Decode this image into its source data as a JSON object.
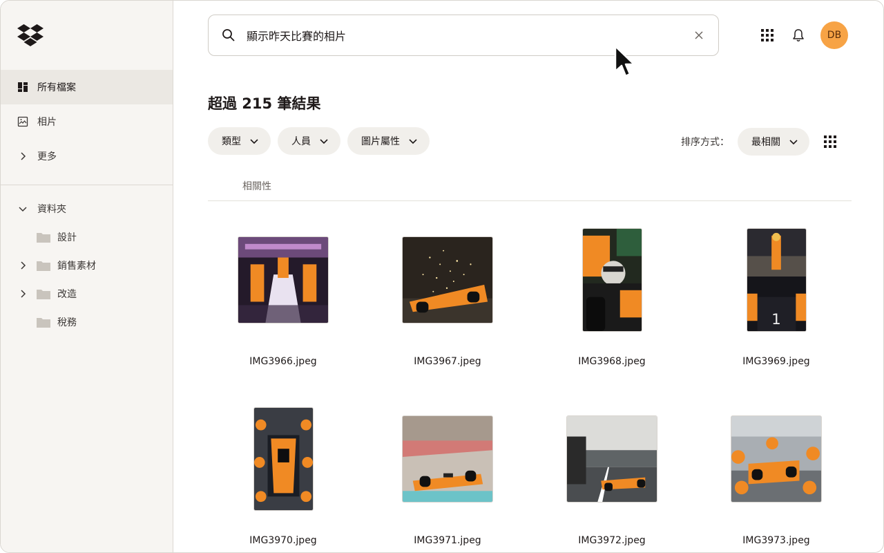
{
  "sidebar": {
    "logo_icon": "dropbox-logo",
    "nav": [
      {
        "label": "所有檔案",
        "icon": "all-files-icon",
        "active": true
      },
      {
        "label": "相片",
        "icon": "photos-icon",
        "active": false
      },
      {
        "label": "更多",
        "icon": "chevron-right-icon",
        "active": false
      }
    ],
    "folders_header": "資料夾",
    "folders": [
      {
        "label": "設計",
        "expandable": false
      },
      {
        "label": "銷售素材",
        "expandable": true
      },
      {
        "label": "改造",
        "expandable": true
      },
      {
        "label": "稅務",
        "expandable": false
      }
    ]
  },
  "search": {
    "value": "顯示昨天比賽的相片",
    "icon": "search-icon",
    "clear_icon": "close-icon"
  },
  "header_icons": [
    "apps-grid-icon",
    "bell-icon"
  ],
  "avatar": {
    "initials": "DB",
    "color": "#f7a345"
  },
  "results": {
    "title": "超過 215 筆結果",
    "filters": [
      {
        "label": "類型"
      },
      {
        "label": "人員"
      },
      {
        "label": "圖片屬性"
      }
    ],
    "sort_label": "排序方式：",
    "sort_value": "最相關",
    "column_header": "相關性",
    "files": [
      {
        "name": "IMG3966.jpeg",
        "orientation": "landscape"
      },
      {
        "name": "IMG3967.jpeg",
        "orientation": "landscape"
      },
      {
        "name": "IMG3968.jpeg",
        "orientation": "portrait"
      },
      {
        "name": "IMG3969.jpeg",
        "orientation": "portrait"
      },
      {
        "name": "IMG3970.jpeg",
        "orientation": "portrait"
      },
      {
        "name": "IMG3971.jpeg",
        "orientation": "landscape"
      },
      {
        "name": "IMG3972.jpeg",
        "orientation": "landscape"
      },
      {
        "name": "IMG3973.jpeg",
        "orientation": "landscape"
      }
    ]
  },
  "colors": {
    "sidebar_bg": "#f7f5f2",
    "active_nav": "#ebe8e3",
    "chip_bg": "#f1efeb",
    "accent_orange": "#f7a345",
    "papaya": "#ff8000"
  }
}
